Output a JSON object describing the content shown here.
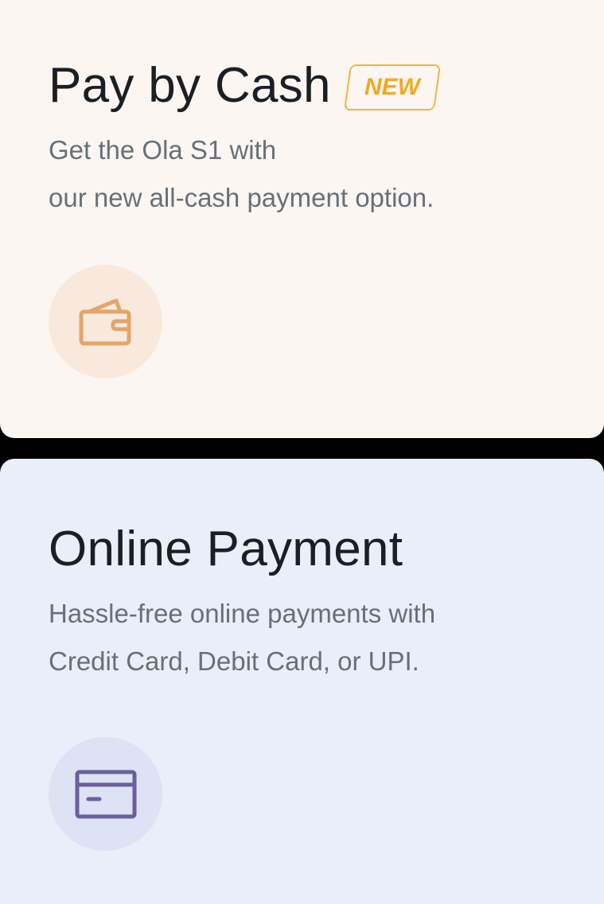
{
  "cash_card": {
    "title": "Pay by Cash",
    "badge": "NEW",
    "desc_line1": "Get the Ola S1 with",
    "desc_line2": "our new all-cash payment option.",
    "icon": "wallet-icon",
    "accent": "#e3a56a",
    "badge_color": "#f0aa23"
  },
  "online_card": {
    "title": "Online Payment",
    "desc_line1": "Hassle-free online payments with",
    "desc_line2": "Credit Card, Debit Card, or UPI.",
    "icon": "credit-card-icon",
    "accent": "#6a5f9e"
  }
}
